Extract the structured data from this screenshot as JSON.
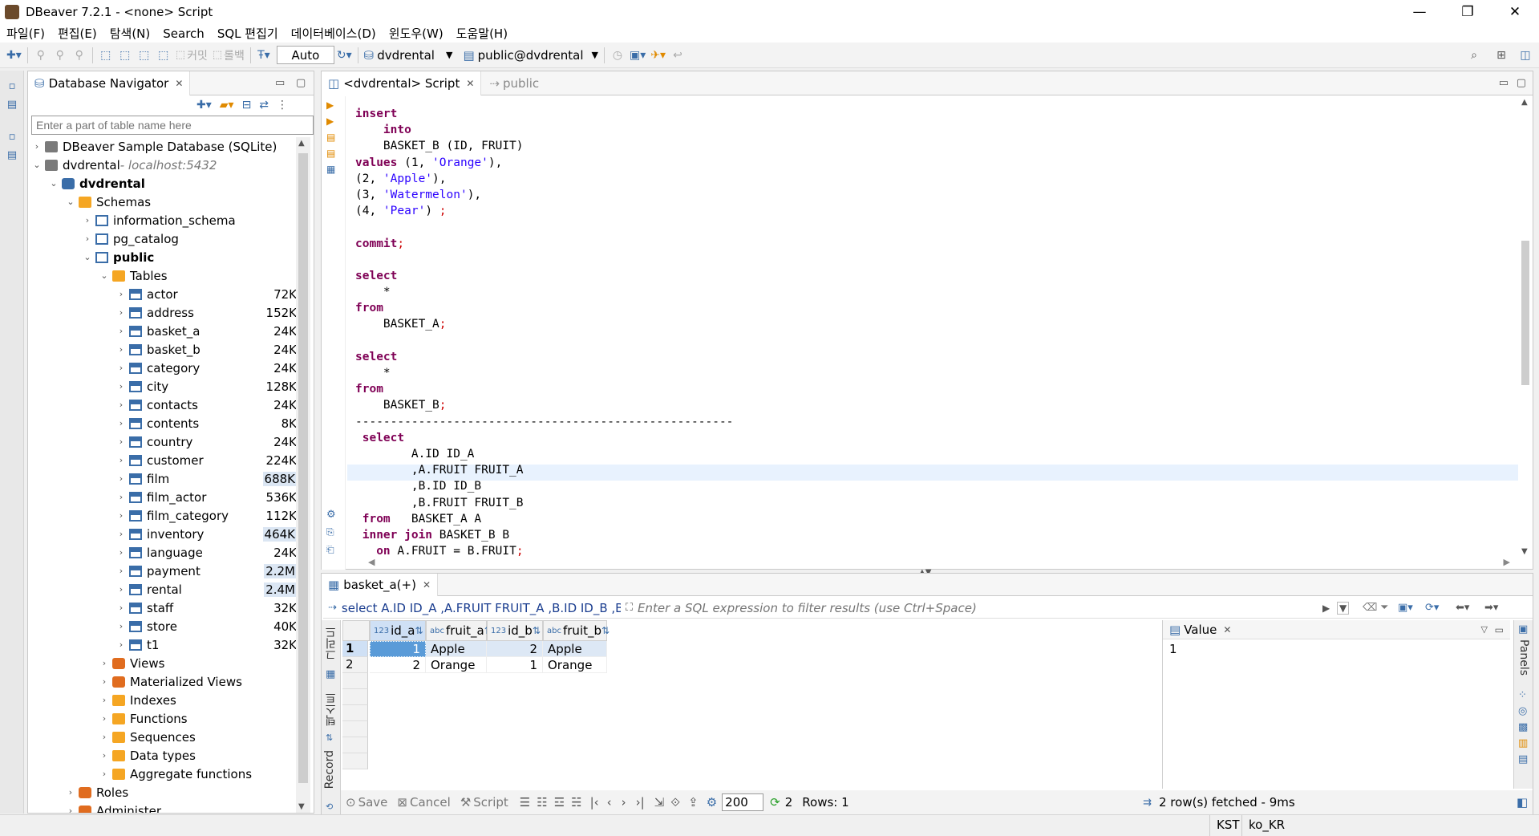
{
  "window": {
    "title": "DBeaver 7.2.1 - <none> Script",
    "controls": [
      "—",
      "❐",
      "✕"
    ]
  },
  "menu": [
    "파일(F)",
    "편집(E)",
    "탐색(N)",
    "Search",
    "SQL 편집기",
    "데이터베이스(D)",
    "윈도우(W)",
    "도움말(H)"
  ],
  "toolbar": {
    "commit_label": "커밋",
    "rollback_label": "롤백",
    "mode": "Auto",
    "connection": "dvdrental",
    "schema": "public@dvdrental"
  },
  "navigator": {
    "title": "Database Navigator",
    "filter_placeholder": "Enter a part of table name here",
    "nodes": [
      {
        "label": "DBeaver Sample Database (SQLite)",
        "depth": 0,
        "arrow": "›",
        "icon": "conn",
        "size": "",
        "bold": false
      },
      {
        "label": "dvdrental",
        "suffix": " - localhost:5432",
        "depth": 0,
        "arrow": "⌄",
        "icon": "conn",
        "size": "",
        "bold": false
      },
      {
        "label": "dvdrental",
        "depth": 1,
        "arrow": "⌄",
        "icon": "db",
        "size": "",
        "bold": true
      },
      {
        "label": "Schemas",
        "depth": 2,
        "arrow": "⌄",
        "icon": "folder",
        "size": "",
        "bold": false
      },
      {
        "label": "information_schema",
        "depth": 3,
        "arrow": "›",
        "icon": "schema",
        "size": "",
        "bold": false
      },
      {
        "label": "pg_catalog",
        "depth": 3,
        "arrow": "›",
        "icon": "schema",
        "size": "",
        "bold": false
      },
      {
        "label": "public",
        "depth": 3,
        "arrow": "⌄",
        "icon": "schema",
        "size": "",
        "bold": true
      },
      {
        "label": "Tables",
        "depth": 4,
        "arrow": "⌄",
        "icon": "folder",
        "size": "",
        "bold": false
      },
      {
        "label": "actor",
        "depth": 5,
        "arrow": "›",
        "icon": "table",
        "size": "72K",
        "bold": false
      },
      {
        "label": "address",
        "depth": 5,
        "arrow": "›",
        "icon": "table",
        "size": "152K",
        "bold": false
      },
      {
        "label": "basket_a",
        "depth": 5,
        "arrow": "›",
        "icon": "table",
        "size": "24K",
        "bold": false
      },
      {
        "label": "basket_b",
        "depth": 5,
        "arrow": "›",
        "icon": "table",
        "size": "24K",
        "bold": false
      },
      {
        "label": "category",
        "depth": 5,
        "arrow": "›",
        "icon": "table",
        "size": "24K",
        "bold": false
      },
      {
        "label": "city",
        "depth": 5,
        "arrow": "›",
        "icon": "table",
        "size": "128K",
        "bold": false
      },
      {
        "label": "contacts",
        "depth": 5,
        "arrow": "›",
        "icon": "table",
        "size": "24K",
        "bold": false
      },
      {
        "label": "contents",
        "depth": 5,
        "arrow": "›",
        "icon": "table",
        "size": "8K",
        "bold": false
      },
      {
        "label": "country",
        "depth": 5,
        "arrow": "›",
        "icon": "table",
        "size": "24K",
        "bold": false
      },
      {
        "label": "customer",
        "depth": 5,
        "arrow": "›",
        "icon": "table",
        "size": "224K",
        "bold": false
      },
      {
        "label": "film",
        "depth": 5,
        "arrow": "›",
        "icon": "table",
        "size": "688K",
        "bold": false,
        "hl": true
      },
      {
        "label": "film_actor",
        "depth": 5,
        "arrow": "›",
        "icon": "table",
        "size": "536K",
        "bold": false
      },
      {
        "label": "film_category",
        "depth": 5,
        "arrow": "›",
        "icon": "table",
        "size": "112K",
        "bold": false
      },
      {
        "label": "inventory",
        "depth": 5,
        "arrow": "›",
        "icon": "table",
        "size": "464K",
        "bold": false,
        "hl": true
      },
      {
        "label": "language",
        "depth": 5,
        "arrow": "›",
        "icon": "table",
        "size": "24K",
        "bold": false
      },
      {
        "label": "payment",
        "depth": 5,
        "arrow": "›",
        "icon": "table",
        "size": "2.2M",
        "bold": false,
        "hl": true
      },
      {
        "label": "rental",
        "depth": 5,
        "arrow": "›",
        "icon": "table",
        "size": "2.4M",
        "bold": false,
        "hl": true
      },
      {
        "label": "staff",
        "depth": 5,
        "arrow": "›",
        "icon": "table",
        "size": "32K",
        "bold": false
      },
      {
        "label": "store",
        "depth": 5,
        "arrow": "›",
        "icon": "table",
        "size": "40K",
        "bold": false
      },
      {
        "label": "t1",
        "depth": 5,
        "arrow": "›",
        "icon": "table",
        "size": "32K",
        "bold": false
      },
      {
        "label": "Views",
        "depth": 4,
        "arrow": "›",
        "icon": "orange",
        "size": "",
        "bold": false
      },
      {
        "label": "Materialized Views",
        "depth": 4,
        "arrow": "›",
        "icon": "orange",
        "size": "",
        "bold": false
      },
      {
        "label": "Indexes",
        "depth": 4,
        "arrow": "›",
        "icon": "folder",
        "size": "",
        "bold": false
      },
      {
        "label": "Functions",
        "depth": 4,
        "arrow": "›",
        "icon": "folder",
        "size": "",
        "bold": false
      },
      {
        "label": "Sequences",
        "depth": 4,
        "arrow": "›",
        "icon": "folder",
        "size": "",
        "bold": false
      },
      {
        "label": "Data types",
        "depth": 4,
        "arrow": "›",
        "icon": "folder",
        "size": "",
        "bold": false
      },
      {
        "label": "Aggregate functions",
        "depth": 4,
        "arrow": "›",
        "icon": "folder",
        "size": "",
        "bold": false
      },
      {
        "label": "Roles",
        "depth": 2,
        "arrow": "›",
        "icon": "orange",
        "size": "",
        "bold": false
      },
      {
        "label": "Administer",
        "depth": 2,
        "arrow": "›",
        "icon": "orange",
        "size": "",
        "bold": false
      }
    ]
  },
  "editor": {
    "tab_label": "<dvdrental> Script",
    "breadcrumb": "public",
    "lines": [
      [
        [
          "kw",
          "insert"
        ]
      ],
      [
        [
          "",
          "    "
        ],
        [
          "kw",
          "into"
        ]
      ],
      [
        [
          "",
          "    BASKET_B (ID, FRUIT)"
        ]
      ],
      [
        [
          "kw",
          "values"
        ],
        [
          "",
          " (1, "
        ],
        [
          "st",
          "'Orange'"
        ],
        [
          "",
          "),"
        ]
      ],
      [
        [
          "",
          "(2, "
        ],
        [
          "st",
          "'Apple'"
        ],
        [
          "",
          "),"
        ]
      ],
      [
        [
          "",
          "(3, "
        ],
        [
          "st",
          "'Watermelon'"
        ],
        [
          "",
          "),"
        ]
      ],
      [
        [
          "",
          "(4, "
        ],
        [
          "st",
          "'Pear'"
        ],
        [
          "",
          ") "
        ],
        [
          "rd",
          ";"
        ]
      ],
      [
        [
          "",
          ""
        ]
      ],
      [
        [
          "kw",
          "commit"
        ],
        [
          "rd",
          ";"
        ]
      ],
      [
        [
          "",
          ""
        ]
      ],
      [
        [
          "kw",
          "select"
        ]
      ],
      [
        [
          "",
          "    *"
        ]
      ],
      [
        [
          "kw",
          "from"
        ]
      ],
      [
        [
          "",
          "    BASKET_A"
        ],
        [
          "rd",
          ";"
        ]
      ],
      [
        [
          "",
          ""
        ]
      ],
      [
        [
          "kw",
          "select"
        ]
      ],
      [
        [
          "",
          "    *"
        ]
      ],
      [
        [
          "kw",
          "from"
        ]
      ],
      [
        [
          "",
          "    BASKET_B"
        ],
        [
          "rd",
          ";"
        ]
      ],
      [
        [
          "",
          "------------------------------------------------------"
        ]
      ],
      [
        [
          "",
          ""
        ],
        [
          "kw",
          " select"
        ]
      ],
      [
        [
          "",
          "        A.ID ID_A"
        ]
      ],
      [
        [
          "",
          "        ,A.FRUIT FRUIT_A"
        ]
      ],
      [
        [
          "",
          "        ,B.ID ID_B"
        ]
      ],
      [
        [
          "",
          "        ,B.FRUIT FRUIT_B"
        ]
      ],
      [
        [
          "kw",
          " from"
        ],
        [
          "",
          "   BASKET_A A"
        ]
      ],
      [
        [
          "kw",
          " inner join"
        ],
        [
          "",
          " BASKET_B B"
        ]
      ],
      [
        [
          "",
          "   "
        ],
        [
          "kw",
          "on"
        ],
        [
          "",
          " A.FRUIT = B.FRUIT"
        ],
        [
          "rd",
          ";"
        ]
      ]
    ]
  },
  "results": {
    "tab_label": "basket_a(+)",
    "query": "select A.ID ID_A ,A.FRUIT FRUIT_A ,B.ID ID_B ,B.FRU",
    "filter_placeholder": "Enter a SQL expression to filter results (use Ctrl+Space)",
    "columns": [
      "id_a",
      "fruit_a",
      "id_b",
      "fruit_b"
    ],
    "column_types": [
      "123",
      "abc",
      "123",
      "abc"
    ],
    "rows": [
      [
        "1",
        "Apple",
        "2",
        "Apple"
      ],
      [
        "2",
        "Orange",
        "1",
        "Orange"
      ]
    ],
    "row_numbers": [
      "1",
      "2"
    ],
    "value_panel": {
      "title": "Value",
      "value": "1"
    },
    "side_tabs": [
      "그리드",
      "텍스트",
      "Record"
    ],
    "right_tab": "Panels",
    "bottom": {
      "save": "Save",
      "cancel": "Cancel",
      "script": "Script",
      "fetch_size": "200",
      "refresh_count": "2",
      "rows": "Rows: 1",
      "fetched": "2 row(s) fetched - 9ms"
    }
  },
  "status": {
    "timezone": "KST",
    "locale": "ko_KR"
  }
}
